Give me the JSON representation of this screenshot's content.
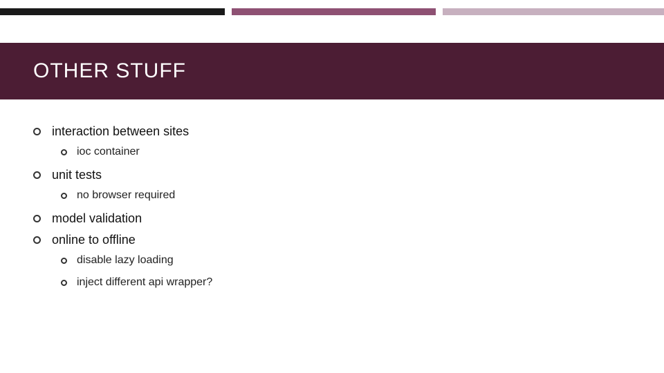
{
  "title": "OTHER STUFF",
  "bullets": [
    {
      "text": "interaction between sites",
      "children": [
        {
          "text": "ioc container"
        }
      ]
    },
    {
      "text": "unit tests",
      "children": [
        {
          "text": "no browser required"
        }
      ]
    },
    {
      "text": "model validation",
      "children": []
    },
    {
      "text": "online to offline",
      "children": [
        {
          "text": "disable lazy loading"
        },
        {
          "text": "inject different api wrapper?"
        }
      ]
    }
  ],
  "colors": {
    "title_band": "#4c1d34",
    "accent_dark": "#1a1a1a",
    "accent_mid": "#8e5173",
    "accent_light": "#c7b0bf"
  }
}
